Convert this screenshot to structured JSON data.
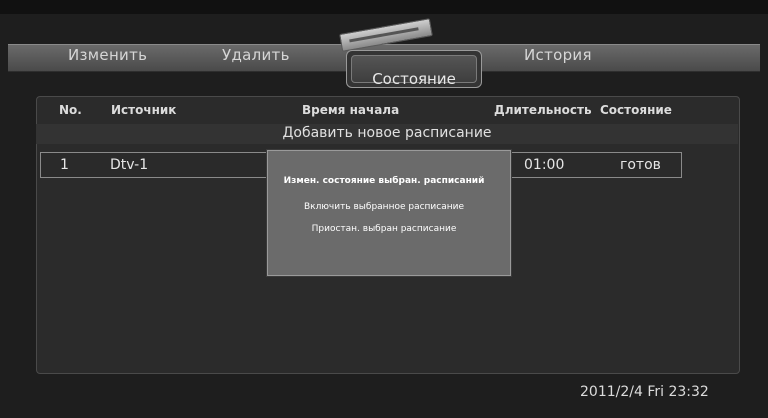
{
  "menu": {
    "tabs": [
      "Изменить",
      "Удалить",
      "Состояние",
      "История"
    ]
  },
  "table": {
    "headers": [
      "No.",
      "Источник",
      "Время начала",
      "Длительность",
      "Состояние"
    ],
    "add_label": "Добавить новое расписание",
    "rows": [
      {
        "no": "1",
        "source": "Dtv-1",
        "duration": "01:00",
        "state": "готов"
      }
    ]
  },
  "popup": {
    "title": "Измен. состояние выбран. расписаний",
    "options": [
      "Включить выбранное расписание",
      "Приостан. выбран расписание"
    ]
  },
  "status": {
    "datetime": "2011/2/4 Fri 23:32"
  }
}
